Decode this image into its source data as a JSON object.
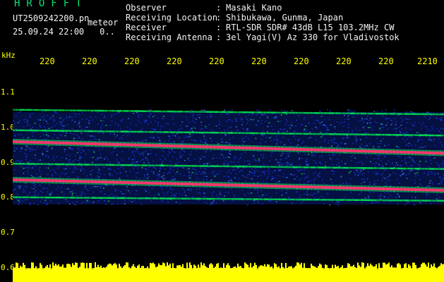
{
  "header": {
    "brand": "HROFFT",
    "filename": "UT2509242200.pn",
    "tag": "meteor",
    "datetime": "25.09.24 22:00",
    "dots": "0.."
  },
  "info": [
    {
      "key": "Observer",
      "value": "Masaki Kano"
    },
    {
      "key": "Receiving Location",
      "value": "Shibukawa, Gunma, Japan"
    },
    {
      "key": "Receiver",
      "value": "RTL-SDR SDR# 43dB L15 103.2MHz CW"
    },
    {
      "key": "Receiving Antenna",
      "value": "3el Yagi(V) Az 330 for Vladivostok"
    }
  ],
  "separator": ":",
  "axis": {
    "unit": "kHz",
    "y_ticks": [
      "1.1",
      "1.0",
      "0.9",
      "0.8",
      "0.7",
      "0.6"
    ],
    "x_ticks": [
      "220",
      "220",
      "220",
      "220",
      "220",
      "220",
      "220",
      "220",
      "220",
      "2210"
    ]
  },
  "colors": {
    "background": "#000000",
    "label": "#ffff00",
    "brand": "#00e676",
    "noise_low": "#1430c8",
    "noise_mid": "#00dc50",
    "signal": "#ff3070",
    "baseline": "#ffff00"
  },
  "chart_data": {
    "type": "heatmap",
    "y_unit": "kHz",
    "ylim": [
      0.6,
      1.1
    ],
    "traces_khz": [
      {
        "start": 0.958,
        "end": 0.925,
        "strength": "strong"
      },
      {
        "start": 0.85,
        "end": 0.82,
        "strength": "strong"
      },
      {
        "start": 1.048,
        "end": 1.035,
        "strength": "weak"
      },
      {
        "start": 0.99,
        "end": 0.975,
        "strength": "weak"
      },
      {
        "start": 0.895,
        "end": 0.88,
        "strength": "weak"
      },
      {
        "start": 0.8,
        "end": 0.79,
        "strength": "weak"
      }
    ],
    "noise_band_khz": [
      0.78,
      1.05
    ],
    "baseline_khz": 0.6
  }
}
